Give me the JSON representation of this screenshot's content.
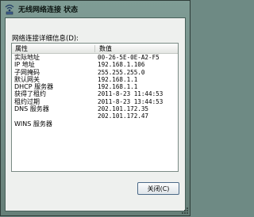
{
  "window": {
    "title": "无线网络连接 状态"
  },
  "details": {
    "group_label": "网络连接详细信息(D):",
    "columns": [
      "属性",
      "数值"
    ],
    "rows": [
      {
        "prop": "实际地址",
        "value": "00-26-5E-0E-A2-F5"
      },
      {
        "prop": "IP 地址",
        "value": "192.168.1.106"
      },
      {
        "prop": "子网掩码",
        "value": "255.255.255.0"
      },
      {
        "prop": "默认网关",
        "value": "192.168.1.1"
      },
      {
        "prop": "DHCP 服务器",
        "value": "192.168.1.1"
      },
      {
        "prop": "获得了租约",
        "value": "2011-8-23 11:44:53"
      },
      {
        "prop": "租约过期",
        "value": "2011-8-23 13:44:53"
      },
      {
        "prop": "DNS 服务器",
        "value": "202.101.172.35"
      },
      {
        "prop": "",
        "value": "202.101.172.47"
      },
      {
        "prop": "WINS 服务器",
        "value": ""
      }
    ]
  },
  "buttons": {
    "close_label": "关闭(C)"
  },
  "icons": {
    "title_icon": "wireless-network-icon",
    "resize": "resize-grip-icon"
  }
}
